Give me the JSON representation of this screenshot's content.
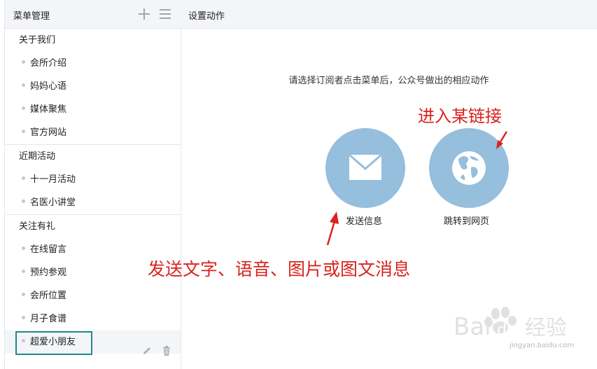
{
  "left_panel": {
    "title": "菜单管理",
    "groups": [
      {
        "label": "关于我们",
        "items": [
          "会所介绍",
          "妈妈心语",
          "媒体聚焦",
          "官方网站"
        ]
      },
      {
        "label": "近期活动",
        "items": [
          "十一月活动",
          "名医小讲堂"
        ]
      },
      {
        "label": "关注有礼",
        "items": [
          "在线留言",
          "预约参观",
          "会所位置",
          "月子食谱",
          "超爱小朋友"
        ]
      }
    ],
    "selected_item": "超爱小朋友"
  },
  "right_panel": {
    "title": "设置动作",
    "hint": "请选择订阅者点击菜单后，公众号做出的相应动作",
    "actions": [
      {
        "label": "发送信息",
        "icon": "envelope-icon"
      },
      {
        "label": "跳转到网页",
        "icon": "globe-icon"
      }
    ]
  },
  "annotations": {
    "link_note": "进入某链接",
    "send_note": "发送文字、语音、图片或图文消息"
  },
  "watermark": {
    "brand": "Baidu经验",
    "url": "jingyan.baidu.com"
  },
  "colors": {
    "circle": "#96bedd",
    "annotation": "#d9231d",
    "highlight_box": "#1f8a86",
    "header_bg": "#f4f5f9"
  }
}
